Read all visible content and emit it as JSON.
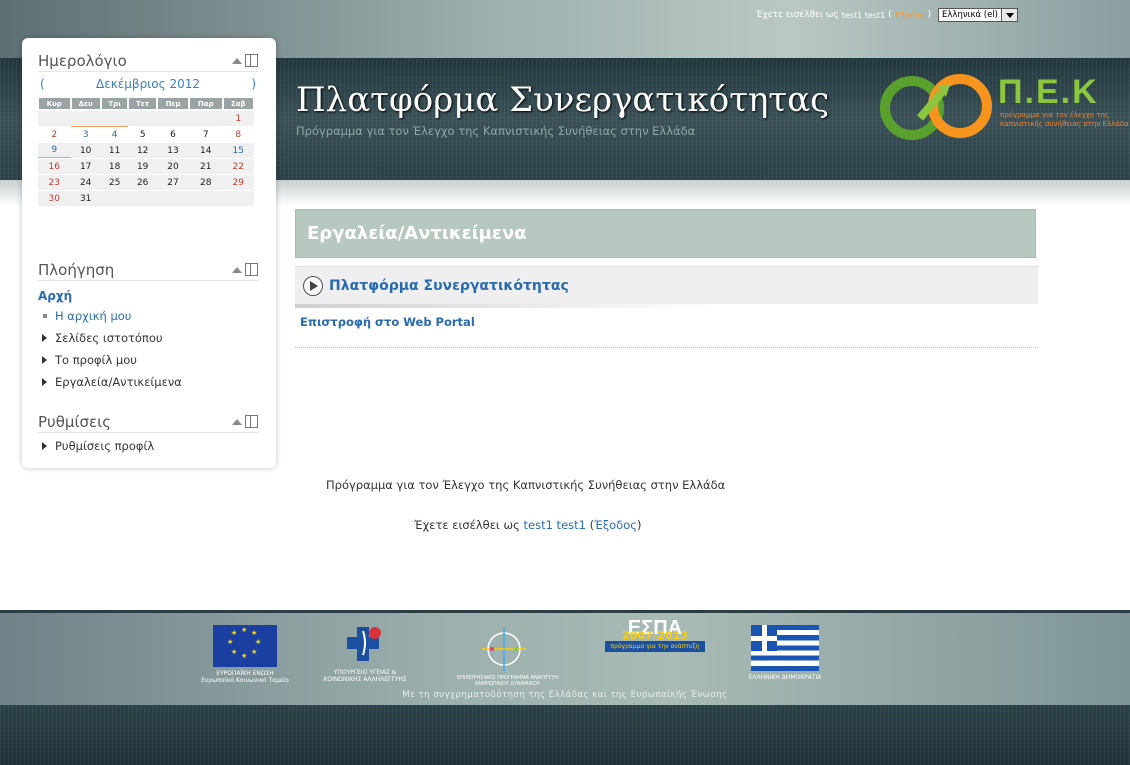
{
  "header": {
    "logged_in_prefix": "Έχετε εισέλθει ως",
    "user": "test1 test1",
    "open_paren": "(",
    "logout": "Έξοδος",
    "close_paren": ")",
    "language": "Ελληνικά (el)",
    "title": "Πλατφόρμα Συνεργατικότητας",
    "subtitle": "Πρόγραμμα για τον Έλεγχο της Καπνιστικής Συνήθειας στην Ελλάδα",
    "logo_letters": "Π.Ε.Κ",
    "logo_tagline": "πρόγραμμα για τον έλεγχο της καπνιστικής συνήθειας στην Ελλάδα"
  },
  "calendar": {
    "title": "Ημερολόγιο",
    "prev": "(",
    "next": ")",
    "month": "Δεκέμβριος 2012",
    "days": [
      "Κυρ",
      "Δευ",
      "Τρι",
      "Τετ",
      "Πεμ",
      "Παρ",
      "Σαβ"
    ],
    "weeks": [
      [
        "",
        "",
        "",
        "",
        "",
        "",
        "1"
      ],
      [
        "2",
        "3",
        "4",
        "5",
        "6",
        "7",
        "8"
      ],
      [
        "9",
        "10",
        "11",
        "12",
        "13",
        "14",
        "15"
      ],
      [
        "16",
        "17",
        "18",
        "19",
        "20",
        "21",
        "22"
      ],
      [
        "23",
        "24",
        "25",
        "26",
        "27",
        "28",
        "29"
      ],
      [
        "30",
        "31",
        "",
        "",
        "",
        "",
        ""
      ]
    ]
  },
  "navigation": {
    "title": "Πλοήγηση",
    "home": "Αρχή",
    "items": [
      "Η αρχική μου",
      "Σελίδες ιστοτόπου",
      "Το προφίλ μου",
      "Εργαλεία/Αντικείμενα"
    ]
  },
  "settings": {
    "title": "Ρυθμίσεις",
    "items": [
      "Ρυθμίσεις προφίλ"
    ]
  },
  "main": {
    "heading": "Εργαλεία/Αντικείμενα",
    "subheading": "Πλατφόρμα Συνεργατικότητας",
    "portal_link": "Επιστροφή στο Web Portal"
  },
  "footer": {
    "program_text": "Πρόγραμμα για τον Έλεγχο της Καπνιστικής Συνήθειας στην Ελλάδα",
    "logged_in_prefix": "Έχετε εισέλθει ως",
    "user": "test1 test1",
    "logout": "Έξοδος",
    "logos": {
      "eu": "ΕΥΡΩΠΑΪΚΗ ΕΝΩΣΗ",
      "eu_sub": "Ευρωπαϊκό Κοινωνικό Ταμείο",
      "ministry": "ΥΠΟΥΡΓΕΙΟ ΥΓΕΙΑΣ & ΚΟΙΝΩΝΙΚΗΣ ΑΛΛΗΛΕΓΓΥΗΣ",
      "op": "ΕΠΙΧΕΙΡΗΣΙΑΚΟ ΠΡΟΓΡΑΜΜΑ ΑΝΑΠΤΥΞΗ ΑΝΘΡΩΠΙΝΟΥ ΔΥΝΑΜΙΚΟΥ",
      "espa": "ΕΣΠΑ",
      "espa_years": "2007-2013",
      "espa_sub": "πρόγραμμα για την ανάπτυξη",
      "greece": "ΕΛΛΗΝΙΚΗ ΔΗΜΟΚΡΑΤΙΑ"
    },
    "caption": "Με τη συγχρηματοδότηση της Ελλάδας και της Ευρωπαϊκής Ένωσης"
  },
  "colors": {
    "link": "#2a6bb0",
    "logout": "#ff9a2a",
    "heading_bg": "#b6c8bf",
    "logo_green": "#8cc63f"
  }
}
